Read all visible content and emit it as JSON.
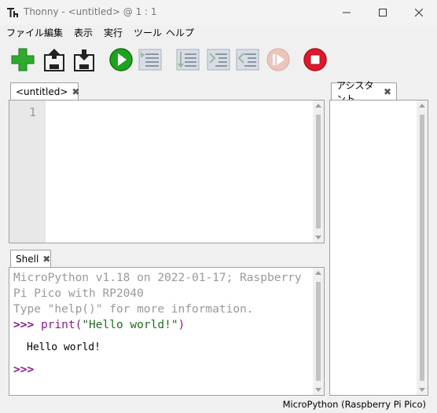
{
  "window": {
    "title": "Thonny  -  <untitled>  @  1 : 1"
  },
  "menu": [
    "ファイル",
    "編集",
    "表示",
    "実行",
    "ツール",
    "ヘルプ"
  ],
  "toolbar": [
    "new",
    "load",
    "save",
    "run",
    "debug",
    "step-over",
    "step-into",
    "step-out",
    "resume",
    "stop"
  ],
  "editor": {
    "tab_label": "<untitled>",
    "line_numbers": [
      "1"
    ]
  },
  "shell": {
    "tab_label": "Shell",
    "banner1": "MicroPython v1.18 on 2022-01-17; Raspberry",
    "banner2": "Pi Pico with RP2040",
    "banner3": "Type \"help()\" for more information.",
    "prompt": ">>>",
    "cmd_fn": "print(",
    "cmd_str": "\"Hello world!\"",
    "cmd_end": ")",
    "output": "Hello world!",
    "prompt2": ">>>"
  },
  "assistant": {
    "tab_label": "アシスタント"
  },
  "status": {
    "interpreter": "MicroPython (Raspberry Pi Pico)"
  },
  "colors": {
    "run": "#1fa31f",
    "stop": "#e0182c",
    "new": "#2eaa2e"
  }
}
